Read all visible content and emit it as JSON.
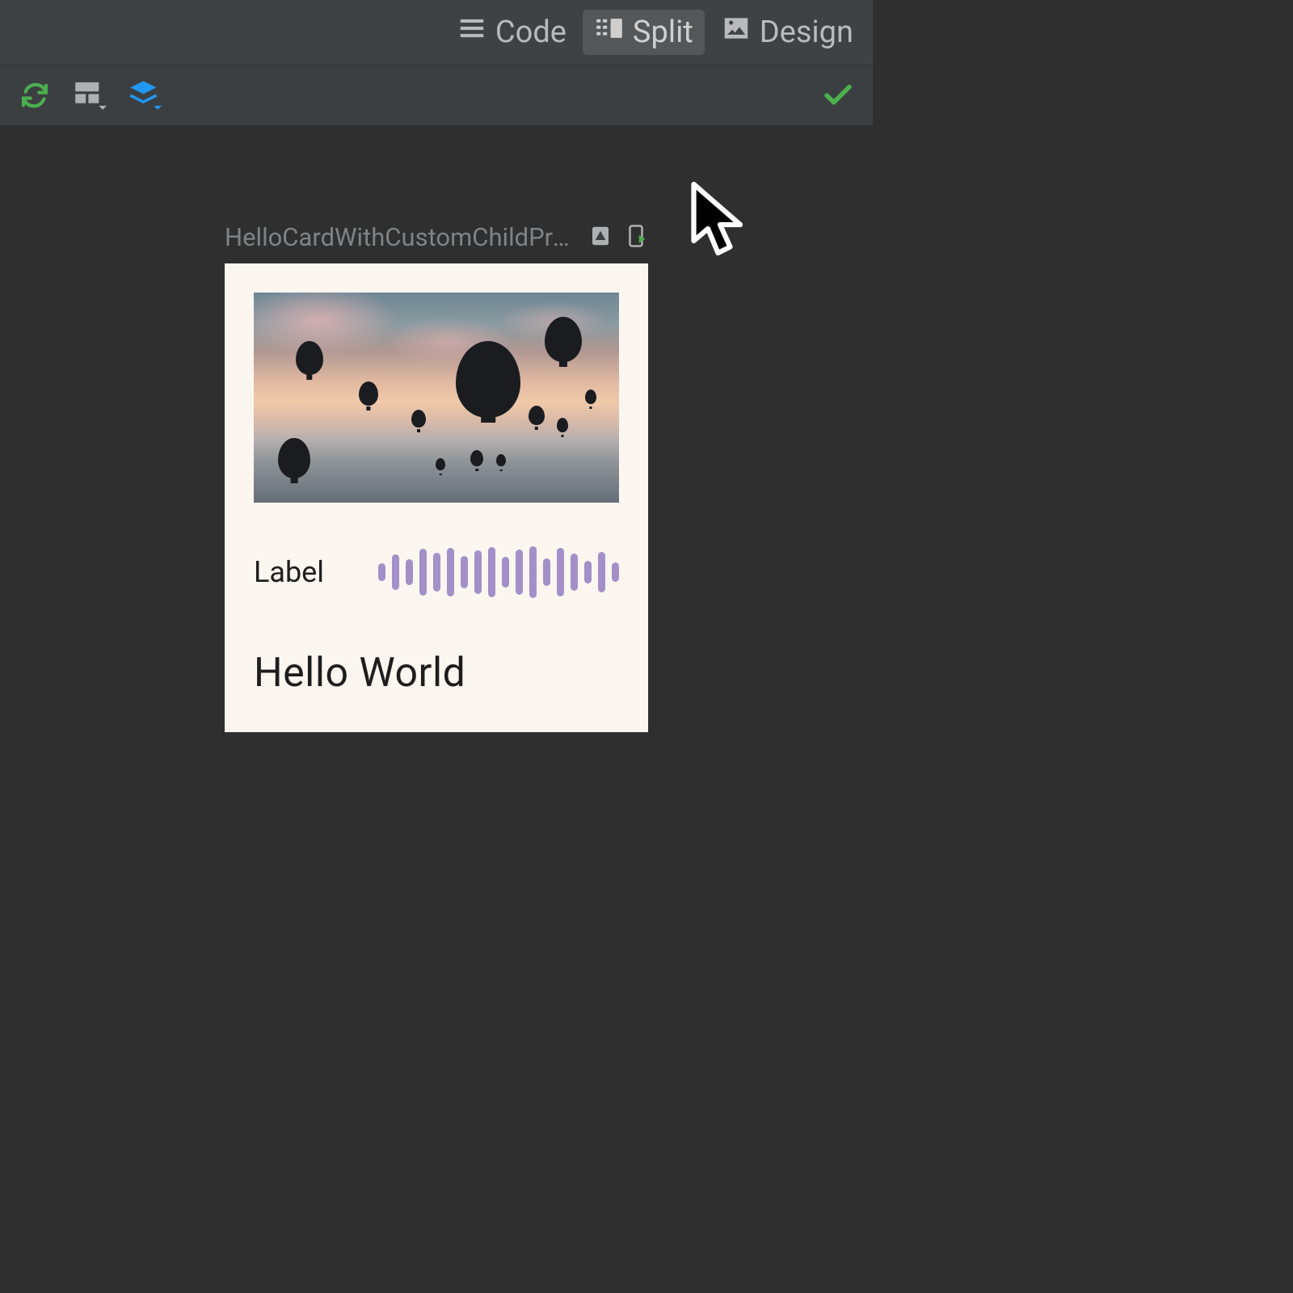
{
  "view_tabs": {
    "code": "Code",
    "split": "Split",
    "design": "Design",
    "active": "split"
  },
  "preview": {
    "title": "HelloCardWithCustomChildPrev..."
  },
  "card": {
    "label": "Label",
    "title": "Hello World"
  },
  "waveform_heights": [
    22,
    44,
    32,
    58,
    48,
    60,
    40,
    54,
    62,
    38,
    56,
    64,
    34,
    60,
    46,
    28,
    50,
    24
  ],
  "colors": {
    "accent_green": "#4caf50",
    "accent_blue": "#2196f3",
    "waveform": "#a390c8"
  }
}
